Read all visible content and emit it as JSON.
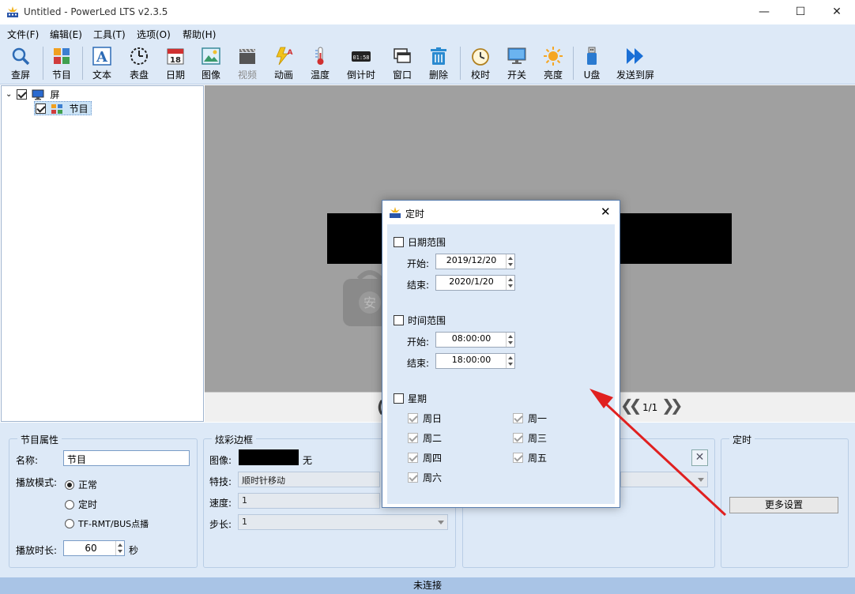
{
  "window": {
    "title": "Untitled - PowerLed LTS v2.3.5",
    "minimize": "—",
    "maximize": "☐",
    "close": "✕"
  },
  "menu": [
    "文件(F)",
    "编辑(E)",
    "工具(T)",
    "选项(O)",
    "帮助(H)"
  ],
  "toolbar": [
    {
      "label": "查屏",
      "icon": "magnifier-icon"
    },
    {
      "label": "节目",
      "icon": "program-icon"
    },
    {
      "label": "文本",
      "icon": "text-icon"
    },
    {
      "label": "表盘",
      "icon": "clock-dial-icon"
    },
    {
      "label": "日期",
      "icon": "calendar-icon"
    },
    {
      "label": "图像",
      "icon": "image-icon"
    },
    {
      "label": "视频",
      "icon": "video-icon",
      "disabled": true
    },
    {
      "label": "动画",
      "icon": "animation-icon"
    },
    {
      "label": "温度",
      "icon": "thermometer-icon"
    },
    {
      "label": "倒计时",
      "icon": "countdown-icon"
    },
    {
      "label": "窗口",
      "icon": "window-icon"
    },
    {
      "label": "删除",
      "icon": "trash-icon"
    },
    {
      "label": "校时",
      "icon": "alarm-clock-icon"
    },
    {
      "label": "开关",
      "icon": "monitor-icon"
    },
    {
      "label": "亮度",
      "icon": "sun-icon"
    },
    {
      "label": "U盘",
      "icon": "usb-icon"
    },
    {
      "label": "发送到屏",
      "icon": "send-icon"
    }
  ],
  "tree": {
    "screen": "屏",
    "program": "节目"
  },
  "nav": {
    "page": "1/1",
    "prev": "❮❮",
    "next": "❯❯"
  },
  "program_props": {
    "title": "节目属性",
    "name_label": "名称:",
    "name_value": "节目",
    "mode_label": "播放模式:",
    "mode_normal": "正常",
    "mode_timed": "定时",
    "mode_tf": "TF-RMT/BUS点播",
    "duration_label": "播放时长:",
    "duration_value": "60",
    "duration_unit": "秒"
  },
  "border": {
    "title": "炫彩边框",
    "image_label": "图像:",
    "image_none": "无",
    "effect_label": "特技:",
    "effect_value": "顺时针移动",
    "speed_label": "速度:",
    "speed_value": "1",
    "step_label": "步长:",
    "step_value": "1"
  },
  "timing_group": {
    "title": "定时",
    "more_button": "更多设置"
  },
  "status": "未连接",
  "dialog": {
    "title": "定时",
    "close": "✕",
    "date_range": "日期范围",
    "start_label": "开始:",
    "end_label": "结束:",
    "date_start": "2019/12/20",
    "date_end": "2020/1/20",
    "time_range": "时间范围",
    "time_start": "08:00:00",
    "time_end": "18:00:00",
    "week": "星期",
    "days": [
      "周日",
      "周一",
      "周二",
      "周三",
      "周四",
      "周五",
      "周六"
    ]
  },
  "colors": {
    "panel_bg": "#dde9f7",
    "status_bg": "#a9c4e6",
    "canvas_bg": "#a0a0a0",
    "arrow": "#e02020",
    "send_icon": "#1a6fd6"
  }
}
